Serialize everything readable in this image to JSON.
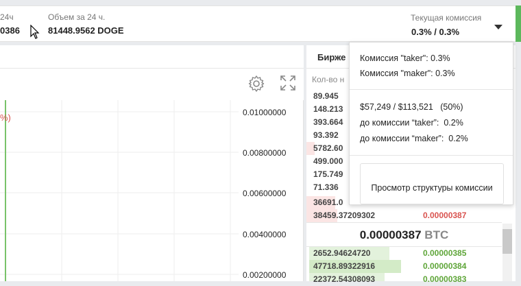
{
  "topbar": {
    "stat1_label": "24ч",
    "stat1_value": "0386",
    "stat2_label": "Объем за 24 ч.",
    "stat2_value": "81448.9562 DOGE",
    "commission_label": "Текущая комиссия",
    "commission_value": "0.3% / 0.3%"
  },
  "chart": {
    "change_fragment": "%)",
    "y_ticks": [
      "0.01000000",
      "0.00800000",
      "0.00600000",
      "0.00400000",
      "0.00200000"
    ]
  },
  "order_book": {
    "title": "Бирже",
    "column_header": "Кол-во н",
    "sell_rows": [
      {
        "amount": "89.945",
        "price": ""
      },
      {
        "amount": "148.213",
        "price": ""
      },
      {
        "amount": "393.664",
        "price": ""
      },
      {
        "amount": "93.392",
        "price": ""
      },
      {
        "amount": "5782.60",
        "price": ""
      },
      {
        "amount": "499.000",
        "price": ""
      },
      {
        "amount": "175.749",
        "price": ""
      },
      {
        "amount": "71.336",
        "price": ""
      },
      {
        "amount": "36691.0",
        "price": ""
      },
      {
        "amount": "38459.37209302",
        "price": "0.00000387"
      }
    ],
    "mid_price": "0.00000387",
    "mid_currency": "BTC",
    "buy_rows": [
      {
        "amount": "2652.94624720",
        "price": "0.00000385"
      },
      {
        "amount": "47718.89322916",
        "price": "0.00000384"
      },
      {
        "amount": "22372.54308093",
        "price": "0.00000383"
      }
    ]
  },
  "dropdown": {
    "taker_fee": "Комиссия \"taker\": 0.3%",
    "maker_fee": "Комиссия \"maker\": 0.3%",
    "volume_progress": "$57,249 / $113,521",
    "volume_percent": "(50%)",
    "next_taker": "до комиссии “taker”:",
    "next_taker_value": "0.2%",
    "next_maker": "до комиссии “maker”:",
    "next_maker_value": "0.2%",
    "fee_structure_button": "Просмотр структуры комиссии"
  },
  "colors": {
    "sell": "#d9534f",
    "buy": "#5ea538",
    "accent_green": "#5cb85c"
  }
}
